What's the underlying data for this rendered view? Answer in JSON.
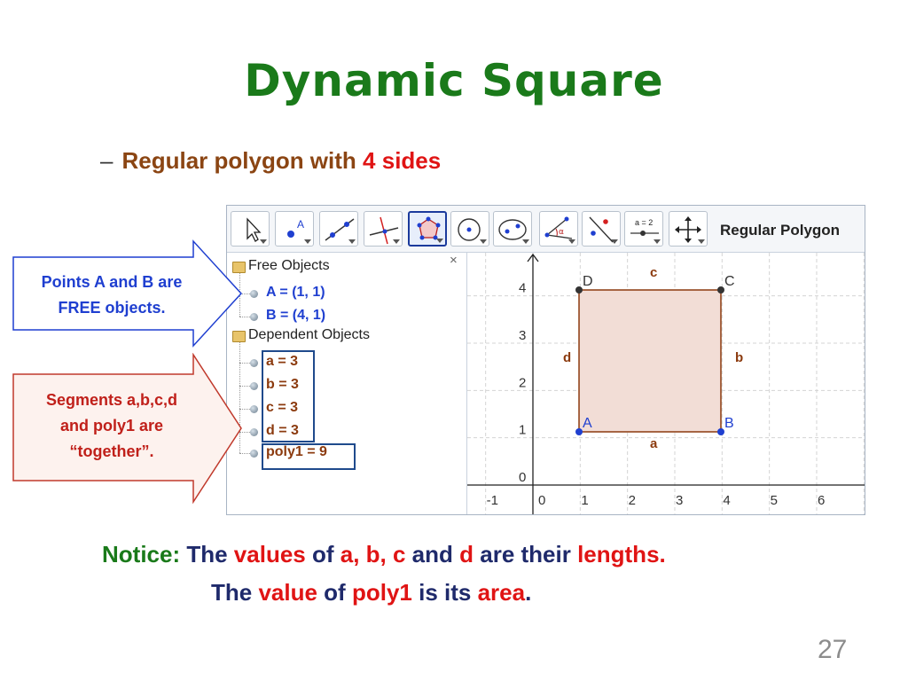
{
  "slide": {
    "title": "Dynamic Square",
    "subtitle_dash": "–",
    "subtitle_prefix": "Regular polygon with",
    "subtitle_highlight": "4 sides",
    "page_number": "27"
  },
  "callouts": {
    "free": {
      "line1": "Points A and B are",
      "line2": "FREE objects."
    },
    "dependent": {
      "line1": "Segments a,b,c,d",
      "line2": "and poly1  are",
      "line3": "“together”."
    }
  },
  "toolbar": {
    "tools": [
      {
        "icon": "move-arrow-icon"
      },
      {
        "icon": "point-icon",
        "label": "A"
      },
      {
        "icon": "line-icon"
      },
      {
        "icon": "perpendicular-line-icon"
      },
      {
        "icon": "regular-polygon-icon"
      },
      {
        "icon": "circle-icon"
      },
      {
        "icon": "ellipse-icon"
      },
      {
        "icon": "angle-icon",
        "label": "α"
      },
      {
        "icon": "reflect-icon"
      },
      {
        "icon": "slider-icon",
        "label": "a = 2"
      },
      {
        "icon": "move-graphics-icon"
      }
    ],
    "selected_tool_name": "Regular Polygon"
  },
  "algebra": {
    "close": "×",
    "free_header": "Free Objects",
    "free_items": [
      "A = (1, 1)",
      "B = (4, 1)"
    ],
    "dependent_header": "Dependent Objects",
    "dependent_items": [
      "a = 3",
      "b = 3",
      "c = 3",
      "d = 3",
      "poly1 = 9"
    ]
  },
  "graphics": {
    "x_ticks": [
      "-1",
      "0",
      "1",
      "2",
      "3",
      "4",
      "5",
      "6"
    ],
    "y_ticks": [
      "0",
      "1",
      "2",
      "3",
      "4"
    ],
    "points": {
      "A": "A",
      "B": "B",
      "C": "C",
      "D": "D"
    },
    "segments": {
      "a": "a",
      "b": "b",
      "c": "c",
      "d": "d"
    },
    "colors": {
      "polygon_fill": "#f2ddd6",
      "polygon_stroke": "#8b3a0e",
      "point": "#1f3fd0"
    }
  },
  "notice": {
    "label": "Notice:",
    "l1_a": " The ",
    "l1_values": "values",
    "l1_b": " of ",
    "l1_abc": "a, b, c",
    "l1_c": " and ",
    "l1_d": "d",
    "l1_e": "  are their ",
    "l1_lengths": "lengths.",
    "l2_a": "The ",
    "l2_value": "value",
    "l2_b": " of ",
    "l2_poly": "poly1",
    "l2_c": " is its ",
    "l2_area": "area",
    "l2_d": "."
  }
}
